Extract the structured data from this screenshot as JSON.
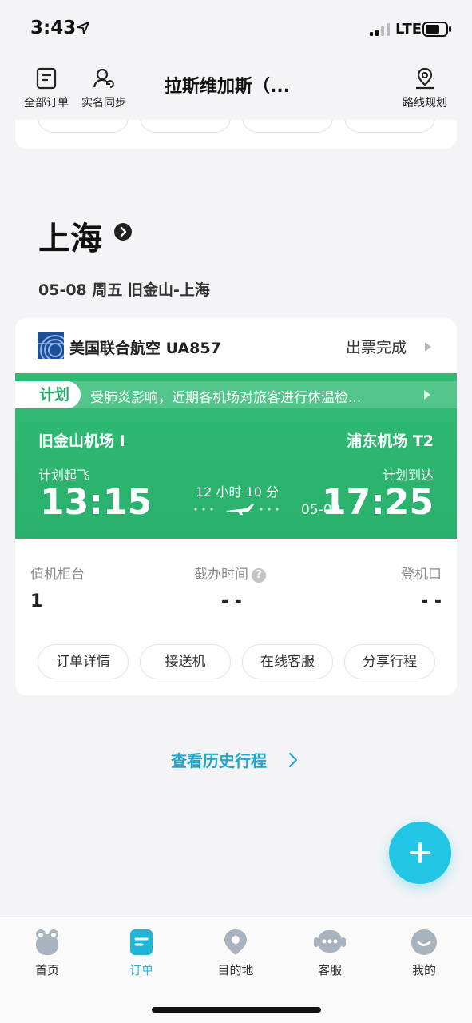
{
  "status_bar": {
    "time": "3:43",
    "network": "LTE"
  },
  "top_nav": {
    "all_orders": "全部订单",
    "realname_sync": "实名同步",
    "title": "拉斯维加斯（...",
    "route_plan": "路线规划"
  },
  "trip": {
    "city": "上海",
    "date_line": "05-08 周五   旧金山-上海",
    "airline": "美国联合航空 UA857",
    "ticket_status": "出票完成",
    "plan_tag": "计划",
    "notice": "受肺炎影响，近期各机场对旅客进行体温检...",
    "dep_airport": "旧金山机场 I",
    "arr_airport": "浦东机场 T2",
    "dep_label": "计划起飞",
    "arr_label": "计划到达",
    "dep_time": "13:15",
    "arr_time": "17:25",
    "arr_date": "05-09",
    "duration": "12 小时 10 分",
    "checkin_label": "值机柜台",
    "checkin_value": "1",
    "cutoff_label": "截办时间",
    "cutoff_value": "- -",
    "gate_label": "登机口",
    "gate_value": "- -",
    "actions": [
      "订单详情",
      "接送机",
      "在线客服",
      "分享行程"
    ]
  },
  "history_link": "查看历史行程",
  "tabs": [
    {
      "label": "首页",
      "icon": "home-mascot-icon"
    },
    {
      "label": "订单",
      "icon": "order-icon",
      "active": true
    },
    {
      "label": "目的地",
      "icon": "location-pin-icon"
    },
    {
      "label": "客服",
      "icon": "chat-service-icon"
    },
    {
      "label": "我的",
      "icon": "profile-icon"
    }
  ],
  "colors": {
    "accent": "#1fb6d6",
    "flight_green": "#2ab06c",
    "fab": "#22c6e4"
  }
}
